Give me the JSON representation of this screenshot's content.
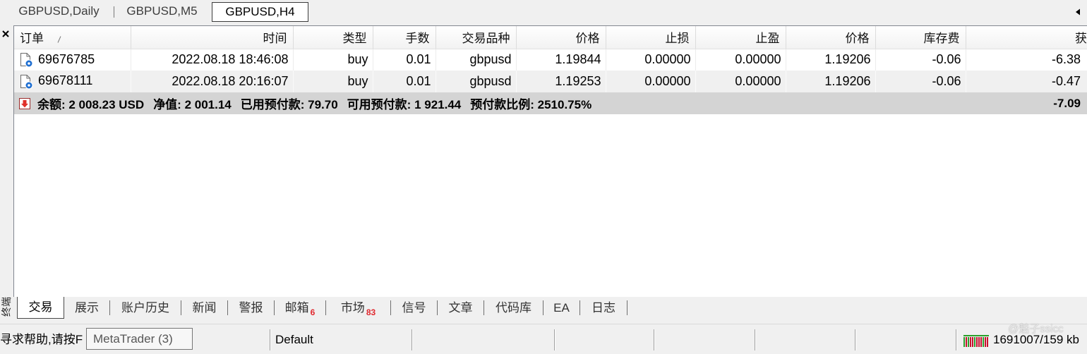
{
  "chart_tabs": [
    {
      "label": "GBPUSD,Daily",
      "active": false
    },
    {
      "label": "GBPUSD,M5",
      "active": false
    },
    {
      "label": "GBPUSD,H4",
      "active": true
    }
  ],
  "terminal": {
    "title": "终端",
    "columns": [
      "订单",
      "时间",
      "类型",
      "手数",
      "交易品种",
      "价格",
      "止损",
      "止盈",
      "价格",
      "库存费",
      "获"
    ],
    "rows": [
      [
        "69676785",
        "2022.08.18 18:46:08",
        "buy",
        "0.01",
        "gbpusd",
        "1.19844",
        "0.00000",
        "0.00000",
        "1.19206",
        "-0.06",
        "-6.38"
      ],
      [
        "69678111",
        "2022.08.18 20:16:07",
        "buy",
        "0.01",
        "gbpusd",
        "1.19253",
        "0.00000",
        "0.00000",
        "1.19206",
        "-0.06",
        "-0.47"
      ]
    ],
    "summary": {
      "items": [
        "余额: 2 008.23 USD",
        "净值: 2 001.14",
        "已用预付款: 79.70",
        "可用预付款: 1 921.44",
        "预付款比例: 2510.75%"
      ],
      "profit": "-7.09"
    }
  },
  "bottom_tabs": [
    {
      "label": "交易",
      "active": true
    },
    {
      "label": "展示"
    },
    {
      "label": "账户历史"
    },
    {
      "label": "新闻"
    },
    {
      "label": "警报"
    },
    {
      "label": "邮箱",
      "badge": "6"
    },
    {
      "label": "市场",
      "badge": "83"
    },
    {
      "label": "信号"
    },
    {
      "label": "文章"
    },
    {
      "label": "代码库"
    },
    {
      "label": "EA"
    },
    {
      "label": "日志"
    }
  ],
  "status_bar": {
    "help_text": "寻求帮助,请按F",
    "tooltip": "MetaTrader (3)",
    "profile": "Default",
    "traffic": "1691007/159 kb"
  },
  "watermark": "@魅子ssicc",
  "colors": {
    "alt_row": "#f0f0f0",
    "summary_row": "#d4d4d4",
    "badge": "#e0282e",
    "order_icon": "#1f6fd1",
    "summary_icon": "#e0302a",
    "connection_good": "#2ca02c",
    "connection_bad": "#c8102e"
  },
  "icons": {
    "close": "close-icon",
    "scroll": "scroll-tabs-left-icon",
    "sort": "sort-indicator-icon",
    "order": "order-icon",
    "summary": "balance-down-icon",
    "connection": "connection-status-icon"
  }
}
